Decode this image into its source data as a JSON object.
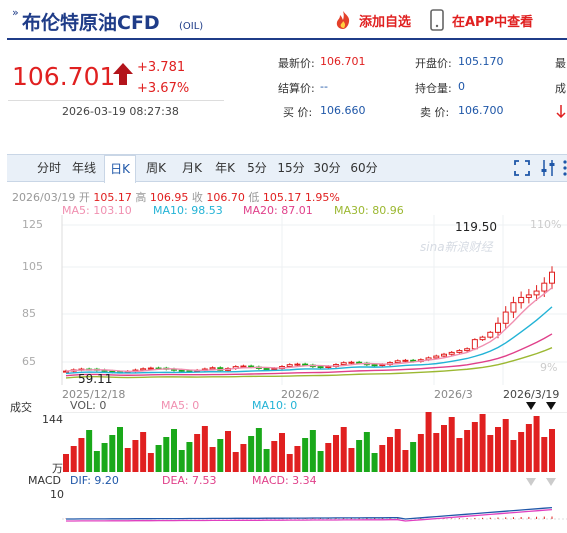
{
  "header": {
    "title": "布伦特原油CFD",
    "code": "(OIL)",
    "add_watch_label": "添加自选",
    "app_view_label": "在APP中查看"
  },
  "quote": {
    "price": "106.701",
    "change": "+3.781",
    "change_pct": "+3.67%",
    "timestamp": "2026-03-19 08:27:38"
  },
  "stats": {
    "latest_label": "最新价:",
    "latest": "106.701",
    "open_label": "开盘价:",
    "open": "105.170",
    "settle_label": "结算价:",
    "settle": "--",
    "hold_label": "持仓量:",
    "hold": "0",
    "bid_label": "买 价:",
    "bid": "106.660",
    "ask_label": "卖 价:",
    "ask": "106.700",
    "cut1": "最",
    "cut2": "成"
  },
  "tabs": [
    {
      "label": "分时"
    },
    {
      "label": "年线"
    },
    {
      "label": "日K"
    },
    {
      "label": "周K"
    },
    {
      "label": "月K"
    },
    {
      "label": "年K"
    },
    {
      "label": "5分"
    },
    {
      "label": "15分"
    },
    {
      "label": "30分"
    },
    {
      "label": "60分"
    }
  ],
  "info": {
    "date": "2026/03/19",
    "open_label": "开",
    "open": "105.17",
    "high_label": "高",
    "high": "106.95",
    "close_label": "收",
    "close": "106.70",
    "low_label": "低",
    "low": "105.17",
    "pct": "1.95%"
  },
  "ma": {
    "ma5": "MA5: 103.10",
    "ma10": "MA10: 98.53",
    "ma20": "MA20: 87.01",
    "ma30": "MA30: 80.96",
    "color_ma5": "#f08fb0",
    "color_ma10": "#23b3d6",
    "color_ma20": "#e0408a",
    "color_ma30": "#9cb832"
  },
  "kline": {
    "y_ticks": [
      "125",
      "105",
      "85",
      "65"
    ],
    "pct_ticks": [
      "110%",
      "9%"
    ],
    "max_label": "119.50",
    "min_label": "59.11",
    "x_labels": [
      "2025/12/18",
      "2026/2",
      "2026/3",
      "2026/3/19"
    ],
    "watermark": "sina新浪财经"
  },
  "volume": {
    "title": "成交",
    "vol": "VOL: 0",
    "ma5": "MA5: 0",
    "ma10": "MA10: 0",
    "y_top": "144",
    "y_unit": "万"
  },
  "macd": {
    "title": "MACD",
    "dif": "DIF: 9.20",
    "dea": "DEA: 7.53",
    "macd": "MACD: 3.34",
    "y_label": "10"
  },
  "colors": {
    "up": "#e02020",
    "down": "#1aa81a",
    "accent": "#1f57a8"
  }
}
